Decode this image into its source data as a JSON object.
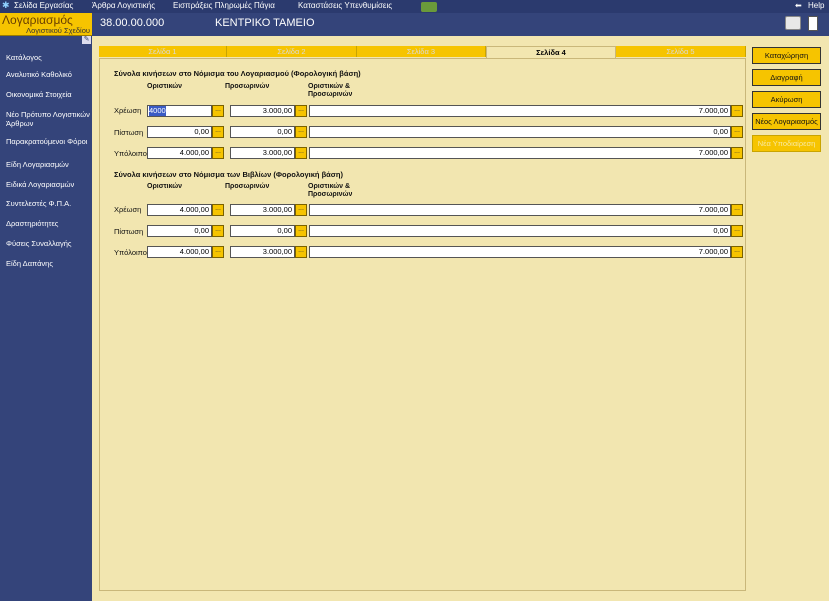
{
  "menubar": {
    "items": [
      "Σελίδα Εργασίας",
      "Άρθρα Λογιστικής",
      "Εισπράξεις Πληρωμές Πάγια",
      "Καταστάσεις Υπενθυμίσεις"
    ],
    "help": "Help"
  },
  "sidebar": {
    "title": "Λογαριασμός",
    "subtitle": "Λογιστικού Σχεδίου",
    "items": [
      "Κατάλογος",
      "Αναλυτικό Καθολικό",
      "Οικονομικά Στοιχεία",
      "Νέο Πρότυπο Λογιστικών Άρθρων",
      "Παρακρατούμενοι Φόροι",
      "Είδη Λογαριασμών",
      "Ειδικά Λογαριασμών",
      "Συντελεστές Φ.Π.Α.",
      "Δραστηριότητες",
      "Φύσεις Συναλλαγής",
      "Είδη Δαπάνης"
    ]
  },
  "header": {
    "account_code": "38.00.00.000",
    "account_name": "ΚΕΝΤΡΙΚΟ ΤΑΜΕΙΟ"
  },
  "tabs": [
    "Σελίδα 1",
    "Σελίδα 2",
    "Σελίδα 3",
    "Σελίδα 4",
    "Σελίδα 5"
  ],
  "active_tab": 3,
  "section1": {
    "title": "Σύνολα κινήσεων στο Νόμισμα του Λογαριασμού (Φορολογική βάση)",
    "col1": "Οριστικών",
    "col2": "Προσωρινών",
    "col3": "Οριστικών & Προσωρινών",
    "rows": [
      {
        "label": "Χρέωση",
        "v1": "4000",
        "v2": "3.000,00",
        "v3": "7.000,00"
      },
      {
        "label": "Πίστωση",
        "v1": "0,00",
        "v2": "0,00",
        "v3": "0,00"
      },
      {
        "label": "Υπόλοιπο",
        "v1": "4.000,00",
        "v2": "3.000,00",
        "v3": "7.000,00"
      }
    ]
  },
  "section2": {
    "title": "Σύνολα κινήσεων στο Νόμισμα των Βιβλίων (Φορολογική βάση)",
    "col1": "Οριστικών",
    "col2": "Προσωρινών",
    "col3": "Οριστικών & Προσωρινών",
    "rows": [
      {
        "label": "Χρέωση",
        "v1": "4.000,00",
        "v2": "3.000,00",
        "v3": "7.000,00"
      },
      {
        "label": "Πίστωση",
        "v1": "0,00",
        "v2": "0,00",
        "v3": "0,00"
      },
      {
        "label": "Υπόλοιπο",
        "v1": "4.000,00",
        "v2": "3.000,00",
        "v3": "7.000,00"
      }
    ]
  },
  "dots_label": "...",
  "buttons": {
    "save": "Καταχώρηση",
    "delete": "Διαγραφή",
    "cancel": "Ακύρωση",
    "new_account": "Νέος Λογαριασμός",
    "disabled": "Νέα Υποδιαίρεση"
  },
  "colors": {
    "accent": "#f6c400",
    "sidebar": "#34447a",
    "panel": "#f2e6b0"
  }
}
